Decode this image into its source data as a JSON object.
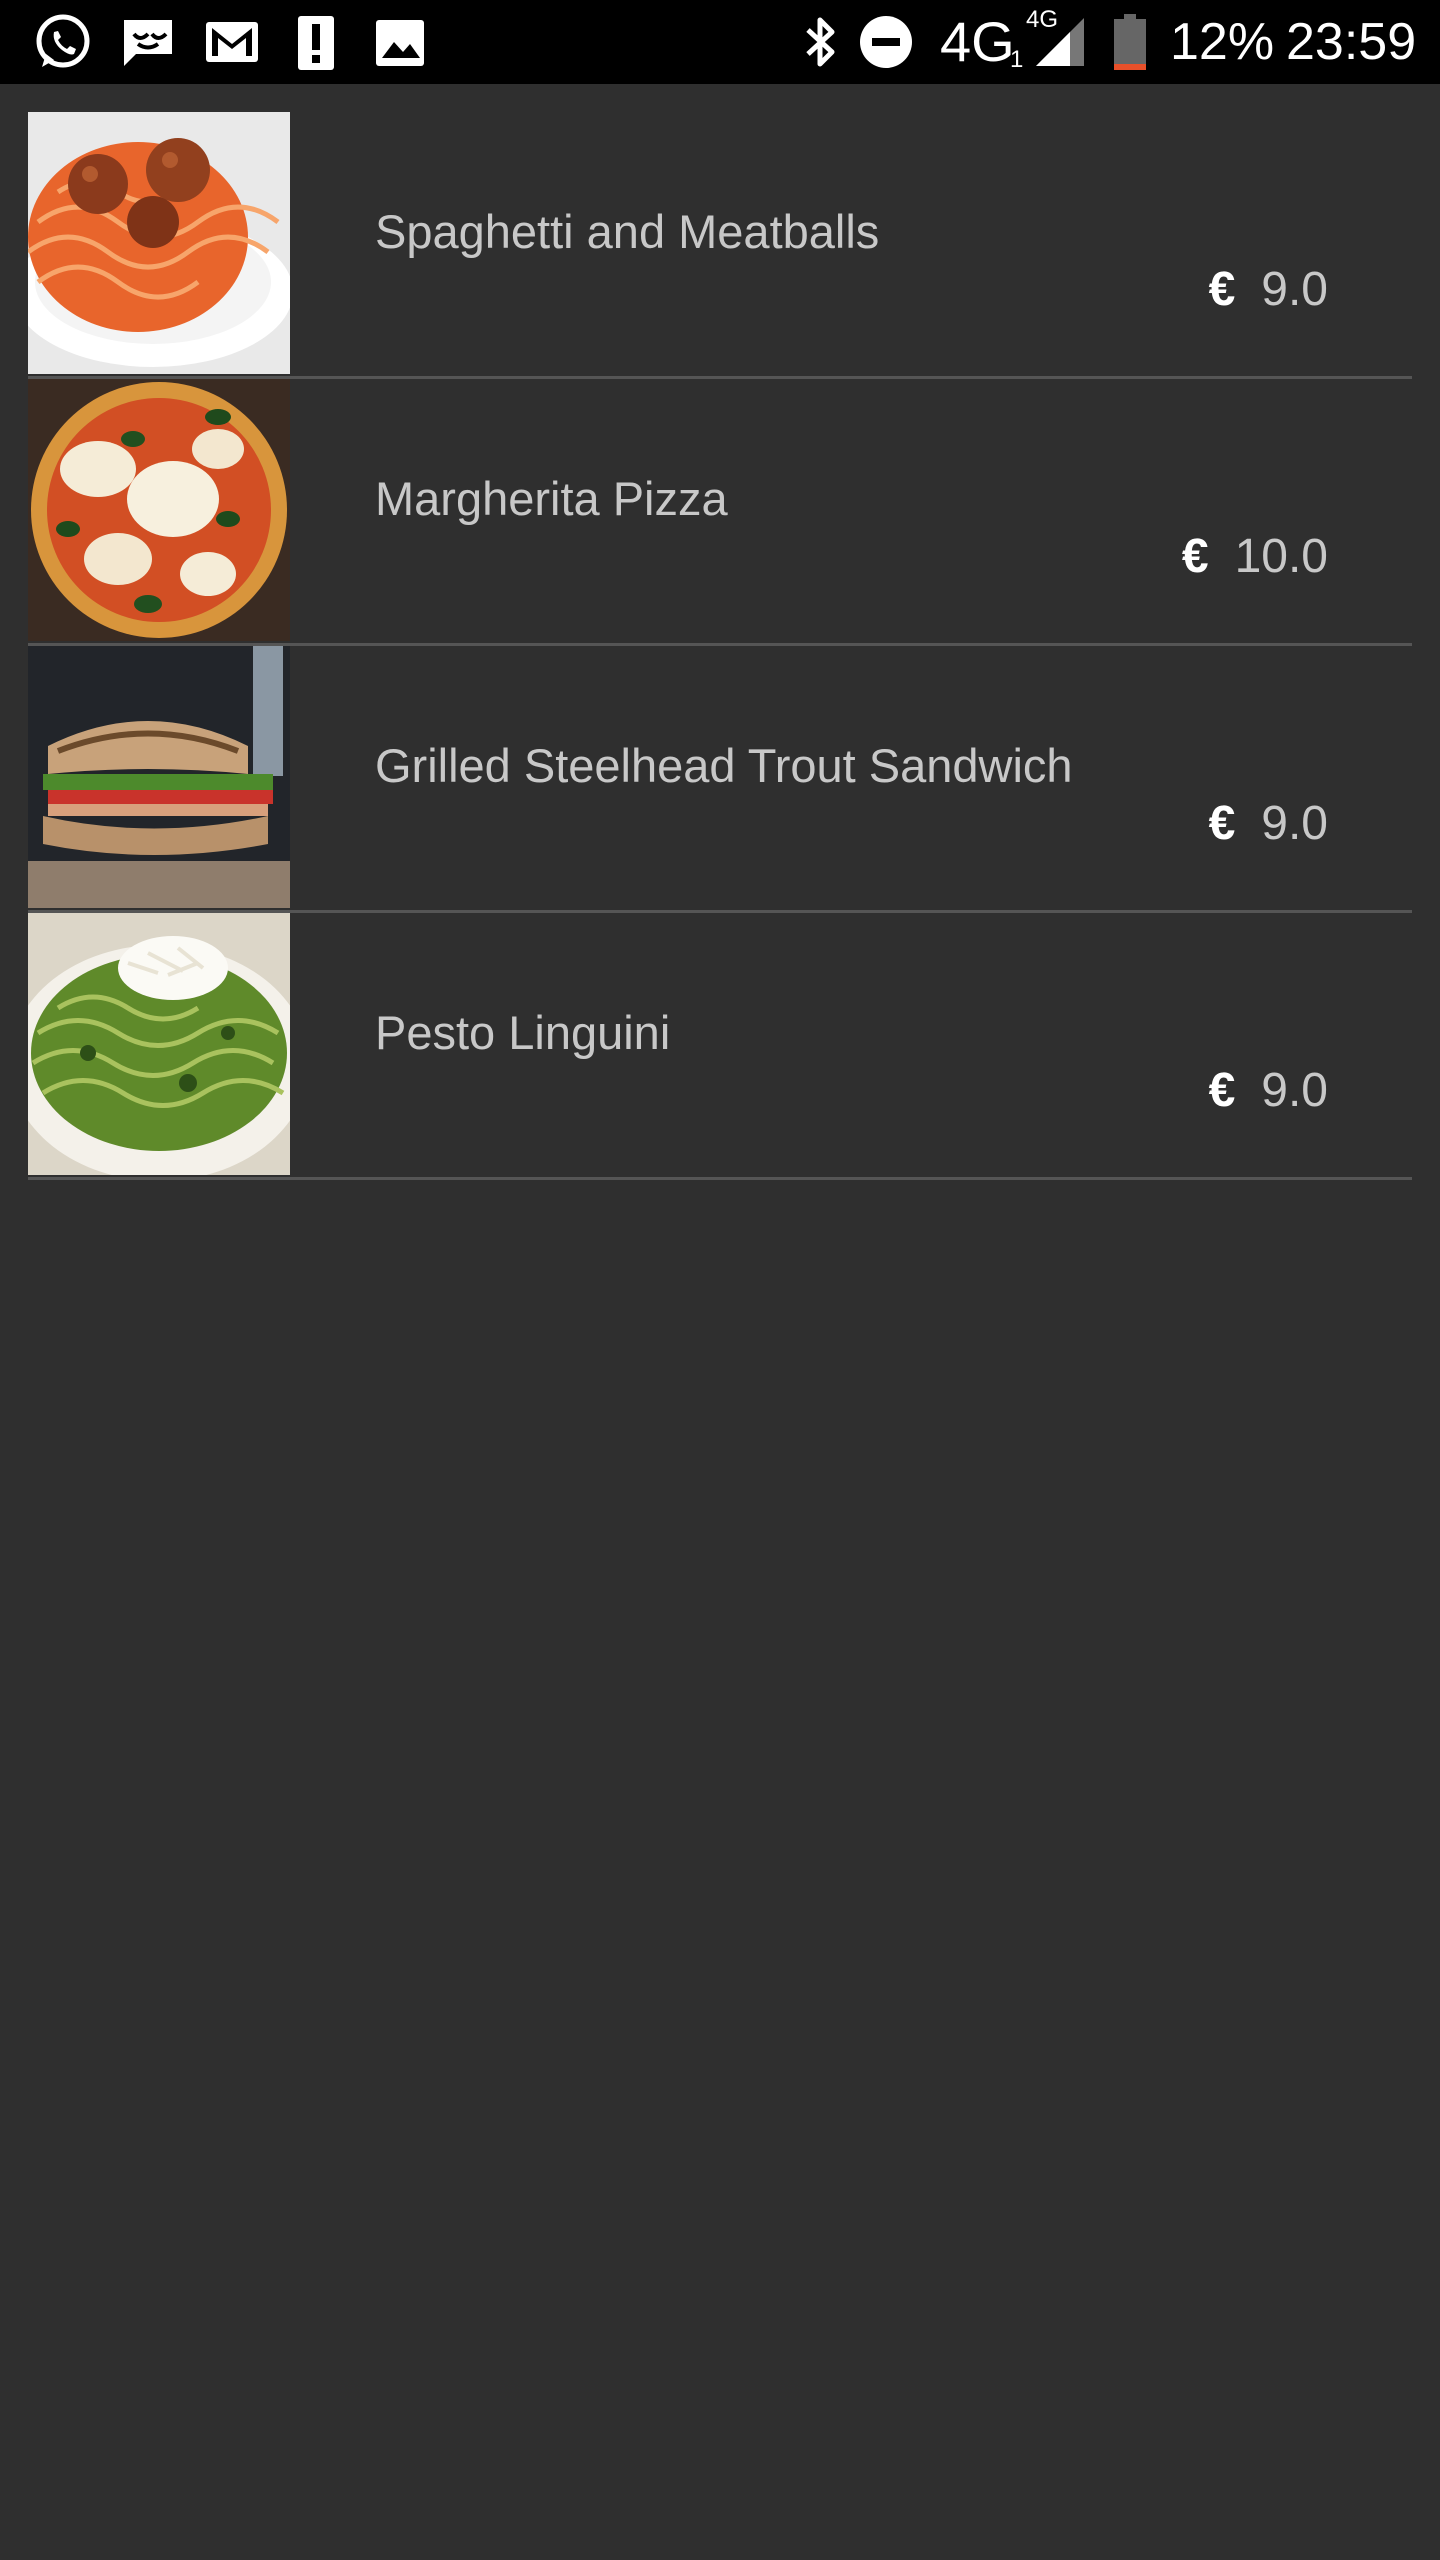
{
  "status_bar": {
    "network_label": "4G",
    "sim_slot": "1",
    "signal_badge": "4G",
    "battery_percent": "12%",
    "time": "23:59",
    "battery_level": 0.12,
    "notification_icons": [
      "whatsapp-icon",
      "messages-icon",
      "gmail-icon",
      "alert-icon",
      "gallery-icon"
    ],
    "system_icons": [
      "bluetooth-icon",
      "do-not-disturb-icon",
      "cell-signal-icon",
      "battery-icon"
    ]
  },
  "menu": {
    "items": [
      {
        "name": "Spaghetti and Meatballs",
        "currency": "€",
        "price": "9.0",
        "image": "spaghetti-meatballs-photo"
      },
      {
        "name": "Margherita Pizza",
        "currency": "€",
        "price": "10.0",
        "image": "margherita-pizza-photo"
      },
      {
        "name": "Grilled Steelhead Trout Sandwich",
        "currency": "€",
        "price": "9.0",
        "image": "trout-sandwich-photo"
      },
      {
        "name": "Pesto Linguini",
        "currency": "€",
        "price": "9.0",
        "image": "pesto-linguini-photo"
      }
    ]
  },
  "colors": {
    "background": "#2f2f2f",
    "status_bar": "#000000",
    "divider": "#555555",
    "text": "#c8c8c8",
    "battery_low": "#e8502a"
  }
}
